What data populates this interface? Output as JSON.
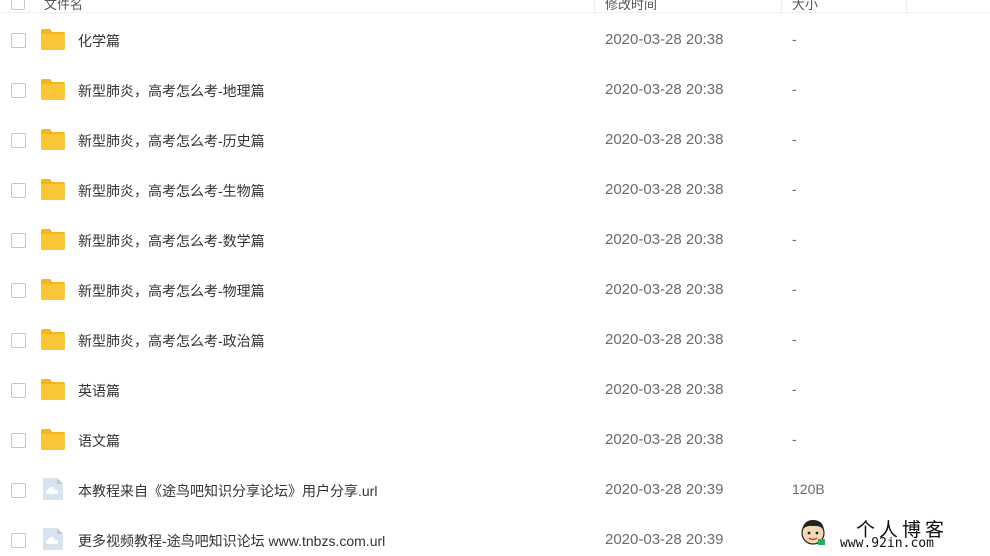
{
  "header": {
    "name_label": "文件名",
    "time_label": "修改时间",
    "size_label": "大小"
  },
  "files": [
    {
      "name": "化学篇",
      "time": "2020-03-28 20:38",
      "size": "-",
      "icon": "folder-icon"
    },
    {
      "name": "新型肺炎，高考怎么考-地理篇",
      "time": "2020-03-28 20:38",
      "size": "-",
      "icon": "folder-icon"
    },
    {
      "name": "新型肺炎，高考怎么考-历史篇",
      "time": "2020-03-28 20:38",
      "size": "-",
      "icon": "folder-icon"
    },
    {
      "name": "新型肺炎，高考怎么考-生物篇",
      "time": "2020-03-28 20:38",
      "size": "-",
      "icon": "folder-icon"
    },
    {
      "name": "新型肺炎，高考怎么考-数学篇",
      "time": "2020-03-28 20:38",
      "size": "-",
      "icon": "folder-icon"
    },
    {
      "name": "新型肺炎，高考怎么考-物理篇",
      "time": "2020-03-28 20:38",
      "size": "-",
      "icon": "folder-icon"
    },
    {
      "name": "新型肺炎，高考怎么考-政治篇",
      "time": "2020-03-28 20:38",
      "size": "-",
      "icon": "folder-icon"
    },
    {
      "name": "英语篇",
      "time": "2020-03-28 20:38",
      "size": "-",
      "icon": "folder-icon"
    },
    {
      "name": "语文篇",
      "time": "2020-03-28 20:38",
      "size": "-",
      "icon": "folder-icon"
    },
    {
      "name": "本教程来自《途鸟吧知识分享论坛》用户分享.url",
      "time": "2020-03-28 20:39",
      "size": "120B",
      "icon": "cloud-file-icon"
    },
    {
      "name": "更多视频教程-途鸟吧知识论坛 www.tnbzs.com.url",
      "time": "2020-03-28 20:39",
      "size": "",
      "icon": "cloud-file-icon"
    }
  ],
  "watermark": {
    "title": "个人博客",
    "url": "www.92in.com"
  },
  "colors": {
    "folder": "#f9c637",
    "folder_tab": "#f5b51d",
    "file_icon_bg": "#d7e3ef",
    "text_primary": "#333333",
    "text_secondary": "#6b6b6b"
  }
}
